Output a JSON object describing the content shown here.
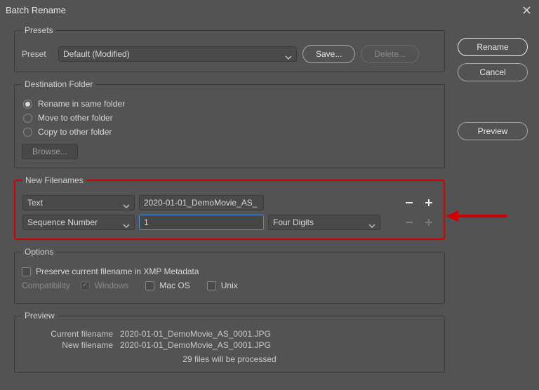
{
  "window": {
    "title": "Batch Rename"
  },
  "actions": {
    "rename": "Rename",
    "cancel": "Cancel",
    "preview": "Preview"
  },
  "presets": {
    "legend": "Presets",
    "label": "Preset",
    "selected": "Default (Modified)",
    "save": "Save...",
    "delete": "Delete..."
  },
  "destination": {
    "legend": "Destination Folder",
    "options": [
      "Rename in same folder",
      "Move to other folder",
      "Copy to other folder"
    ],
    "selected_index": 0,
    "browse": "Browse..."
  },
  "filenames": {
    "legend": "New Filenames",
    "rows": [
      {
        "type": "Text",
        "value": "2020-01-01_DemoMovie_AS_"
      },
      {
        "type": "Sequence Number",
        "value": "1",
        "digits": "Four Digits"
      }
    ]
  },
  "options": {
    "legend": "Options",
    "preserve_xmp_label": "Preserve current filename in XMP Metadata",
    "preserve_xmp": false,
    "compat_label": "Compatibility",
    "windows": "Windows",
    "mac": "Mac OS",
    "unix": "Unix"
  },
  "preview": {
    "legend": "Preview",
    "current_label": "Current filename",
    "current_value": "2020-01-01_DemoMovie_AS_0001.JPG",
    "new_label": "New filename",
    "new_value": "2020-01-01_DemoMovie_AS_0001.JPG",
    "count": "29 files will be processed"
  }
}
